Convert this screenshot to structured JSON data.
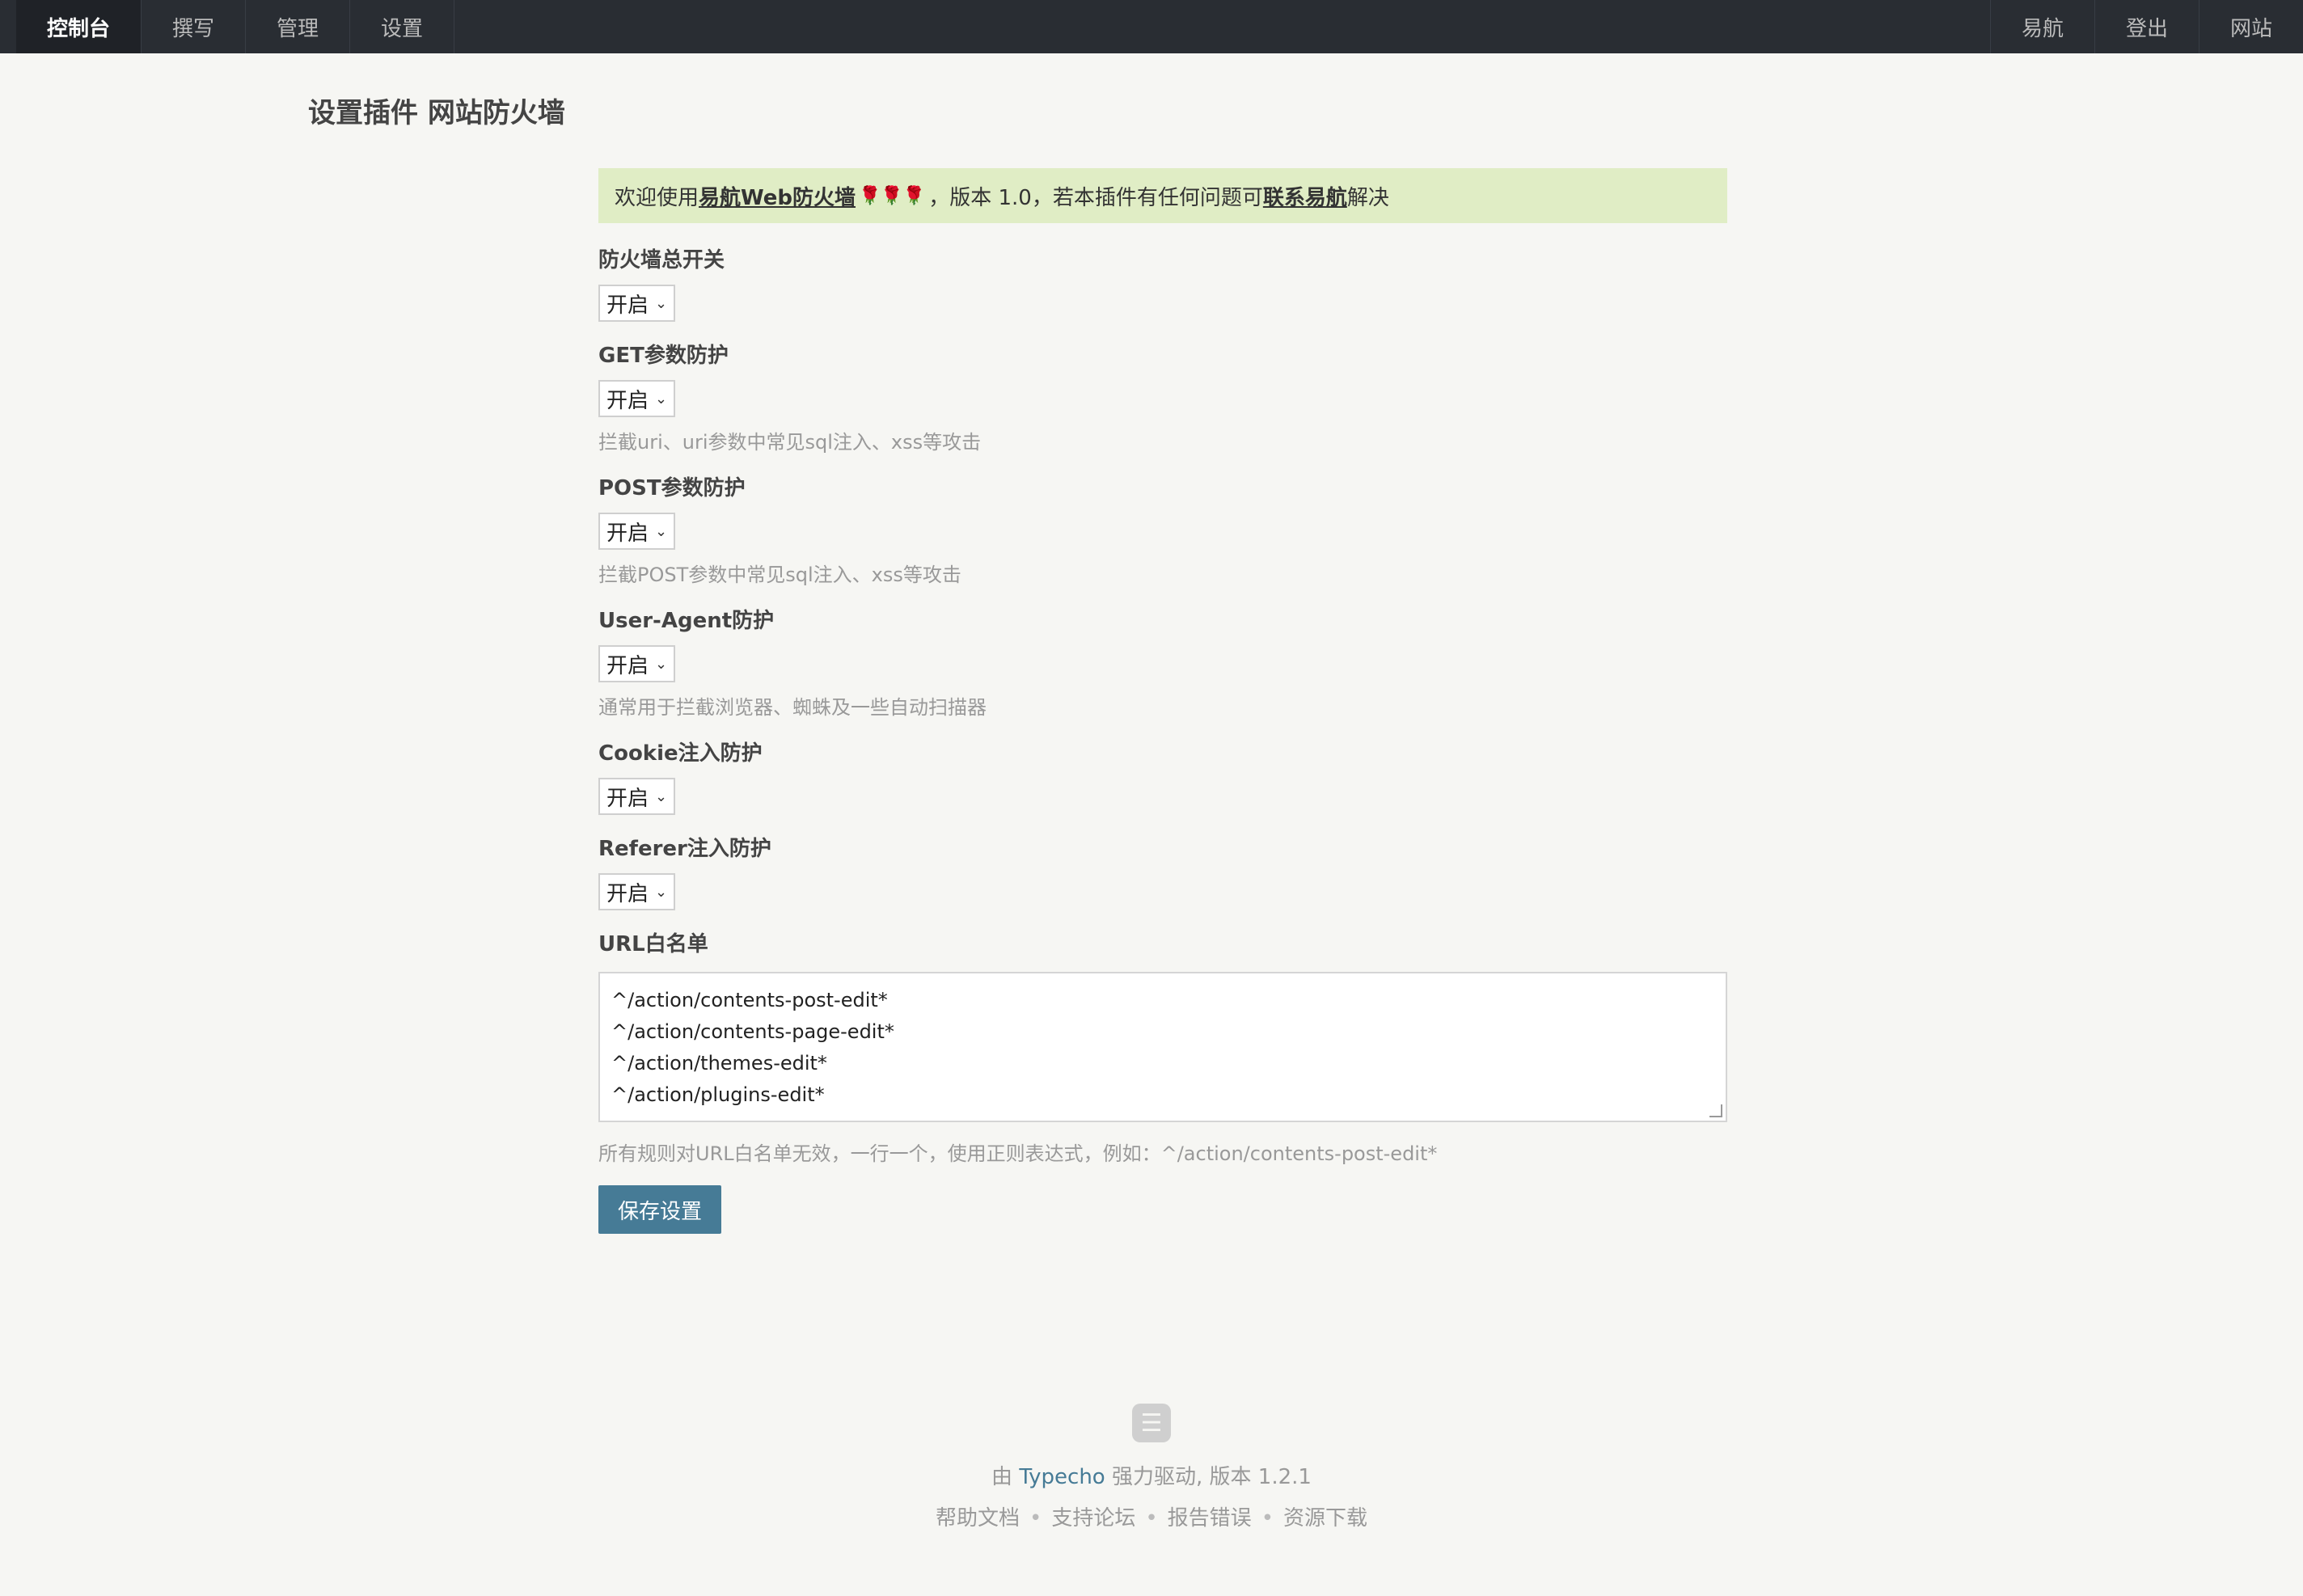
{
  "nav": {
    "left": [
      "控制台",
      "撰写",
      "管理",
      "设置"
    ],
    "right": [
      "易航",
      "登出",
      "网站"
    ]
  },
  "page_title": "设置插件 网站防火墙",
  "notice": {
    "prefix": "欢迎使用 ",
    "plugin_link": "易航Web防火墙",
    "roses": "🌹🌹🌹",
    "middle": "，版本 1.0，若本插件有任何问题可 ",
    "contact_link": "联系易航",
    "suffix": " 解决"
  },
  "fields": [
    {
      "label": "防火墙总开关",
      "value": "开启",
      "desc": ""
    },
    {
      "label": "GET参数防护",
      "value": "开启",
      "desc": "拦截uri、uri参数中常见sql注入、xss等攻击"
    },
    {
      "label": "POST参数防护",
      "value": "开启",
      "desc": "拦截POST参数中常见sql注入、xss等攻击"
    },
    {
      "label": "User-Agent防护",
      "value": "开启",
      "desc": "通常用于拦截浏览器、蜘蛛及一些自动扫描器"
    },
    {
      "label": "Cookie注入防护",
      "value": "开启",
      "desc": ""
    },
    {
      "label": "Referer注入防护",
      "value": "开启",
      "desc": ""
    }
  ],
  "whitelist": {
    "label": "URL白名单",
    "lines": [
      "^/action/contents-post-edit*",
      "^/action/contents-page-edit*",
      "^/action/themes-edit*",
      "^/action/plugins-edit*"
    ],
    "desc": "所有规则对URL白名单无效，一行一个，使用正则表达式，例如：^/action/contents-post-edit*"
  },
  "save_label": "保存设置",
  "footer": {
    "powered_prefix": "由 ",
    "brand": "Typecho",
    "powered_suffix": " 强力驱动, 版本 1.2.1",
    "links": [
      "帮助文档",
      "支持论坛",
      "报告错误",
      "资源下载"
    ],
    "separator": "•"
  },
  "colors": {
    "nav_bg": "#292d33",
    "notice_bg": "#e0edc5",
    "button_bg": "#467b96",
    "brand_link": "#467b96"
  }
}
